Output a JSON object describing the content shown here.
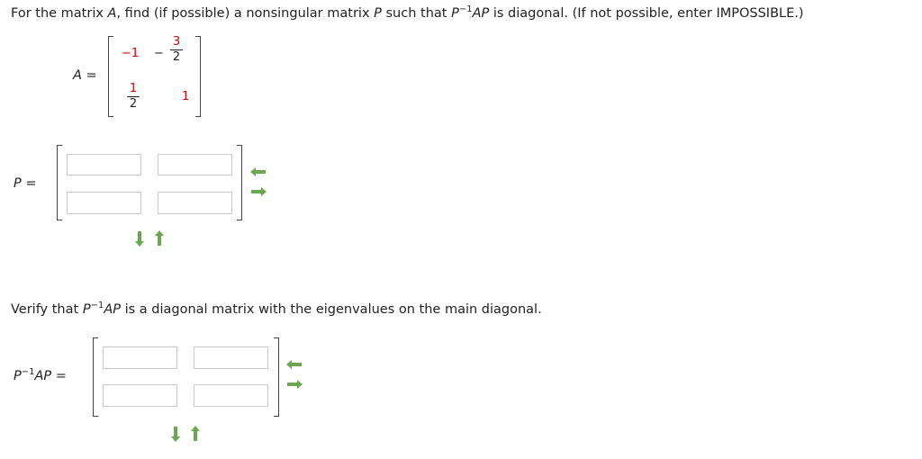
{
  "question": {
    "prefix": "For the matrix ",
    "matrix_var": "A",
    "middle": ", find (if possible) a nonsingular matrix ",
    "p_var": "P",
    "middle2": " such that ",
    "p": "P",
    "inv_exp": "−1",
    "ap": "AP",
    "suffix": " is diagonal. (If not possible, enter IMPOSSIBLE.)"
  },
  "matrix_a": {
    "label_var": "A",
    "label_eq": " =",
    "a11": "−1",
    "a12_sign": "−",
    "a12_num": "3",
    "a12_den": "2",
    "a21_num": "1",
    "a21_den": "2",
    "a22": "1"
  },
  "matrix_p": {
    "label_var": "P",
    "label_eq": " =",
    "cells": [
      "",
      "",
      "",
      ""
    ]
  },
  "verify": {
    "prefix": "Verify that ",
    "p": "P",
    "inv_exp": "−1",
    "ap": "AP",
    "suffix": " is a diagonal matrix with the eigenvalues on the main diagonal."
  },
  "matrix_d": {
    "label_p": "P",
    "label_exp": "−1",
    "label_ap": "AP",
    "label_eq": " =",
    "cells": [
      "",
      "",
      "",
      ""
    ]
  },
  "colors": {
    "red_entries": "#d40000",
    "arrow_green": "#6aa84f"
  }
}
